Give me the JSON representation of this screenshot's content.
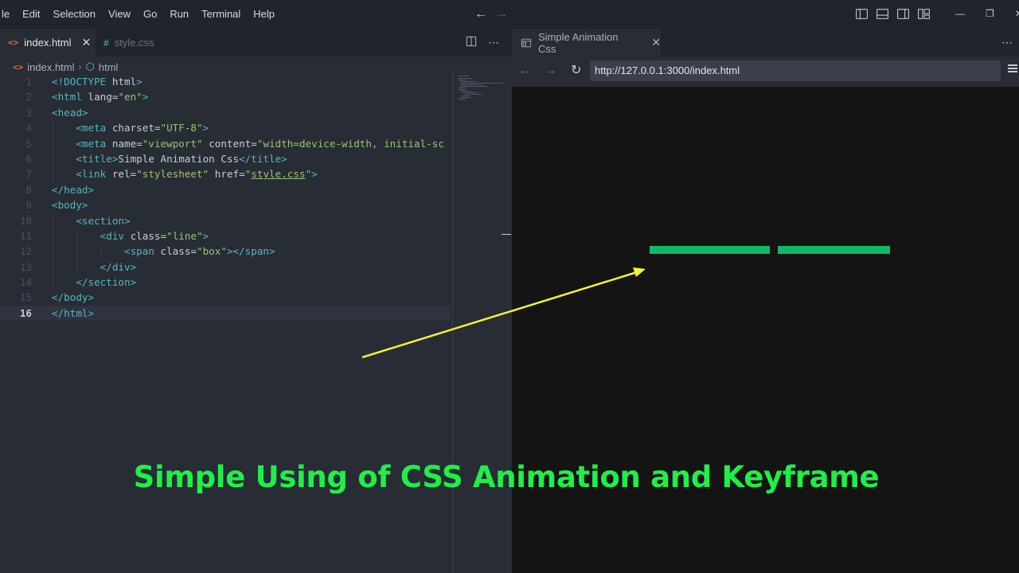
{
  "menu": [
    "le",
    "Edit",
    "Selection",
    "View",
    "Go",
    "Run",
    "Terminal",
    "Help"
  ],
  "window_controls": [
    "—",
    "❐",
    "✕"
  ],
  "editor": {
    "tabs": [
      {
        "label": "index.html",
        "icon": "html-icon",
        "active": true
      },
      {
        "label": "style.css",
        "icon": "css-icon",
        "active": false
      }
    ],
    "breadcrumb": [
      "index.html",
      "html"
    ],
    "lines": [
      {
        "n": "1",
        "html": "<span class='p'>&lt;!DOCTYPE </span><span class='a'>html</span><span class='p'>&gt;</span>"
      },
      {
        "n": "2",
        "html": "<span class='p'>&lt;html </span><span class='a'>lang</span><span class='x'>=</span><span class='s'>\"en\"</span><span class='p'>&gt;</span>"
      },
      {
        "n": "3",
        "html": "<span class='p'>&lt;head&gt;</span>"
      },
      {
        "n": "4",
        "html": "    <span class='p'>&lt;meta </span><span class='a'>charset</span><span class='x'>=</span><span class='s'>\"UTF-8\"</span><span class='p'>&gt;</span>"
      },
      {
        "n": "5",
        "html": "    <span class='p'>&lt;meta </span><span class='a'>name</span><span class='x'>=</span><span class='s'>\"viewport\"</span> <span class='a'>content</span><span class='x'>=</span><span class='s'>\"width=device-width, initial-sc</span>"
      },
      {
        "n": "6",
        "html": "    <span class='p'>&lt;title&gt;</span><span class='x'>Simple Animation Css</span><span class='p'>&lt;/title&gt;</span>"
      },
      {
        "n": "7",
        "html": "    <span class='p'>&lt;link </span><span class='a'>rel</span><span class='x'>=</span><span class='s'>\"stylesheet\"</span> <span class='a'>href</span><span class='x'>=</span><span class='s'>\"<u>style.css</u>\"</span><span class='p'>&gt;</span>"
      },
      {
        "n": "8",
        "html": "<span class='p'>&lt;/head&gt;</span>"
      },
      {
        "n": "9",
        "html": "<span class='p'>&lt;body&gt;</span>"
      },
      {
        "n": "10",
        "html": "    <span class='p'>&lt;section&gt;</span>"
      },
      {
        "n": "11",
        "html": "        <span class='p'>&lt;div </span><span class='a'>class</span><span class='x'>=</span><span class='s'>\"line\"</span><span class='p'>&gt;</span>"
      },
      {
        "n": "12",
        "html": "            <span class='p'>&lt;span </span><span class='a'>class</span><span class='x'>=</span><span class='s'>\"box\"</span><span class='p'>&gt;&lt;/span&gt;</span>"
      },
      {
        "n": "13",
        "html": "        <span class='p'>&lt;/div&gt;</span>"
      },
      {
        "n": "14",
        "html": "    <span class='p'>&lt;/section&gt;</span>"
      },
      {
        "n": "15",
        "html": "<span class='p'>&lt;/body&gt;</span>"
      },
      {
        "n": "16",
        "html": "<span class='p'>&lt;/html&gt;</span>"
      }
    ]
  },
  "browser": {
    "tab_title": "Simple Animation Css",
    "url": "http://127.0.0.1:3000/index.html"
  },
  "colors": {
    "accent_green": "#11b86a",
    "caption_green": "#1ef048",
    "arrow_yellow": "#f2f233"
  },
  "caption": "Simple Using of CSS Animation and Keyframe"
}
